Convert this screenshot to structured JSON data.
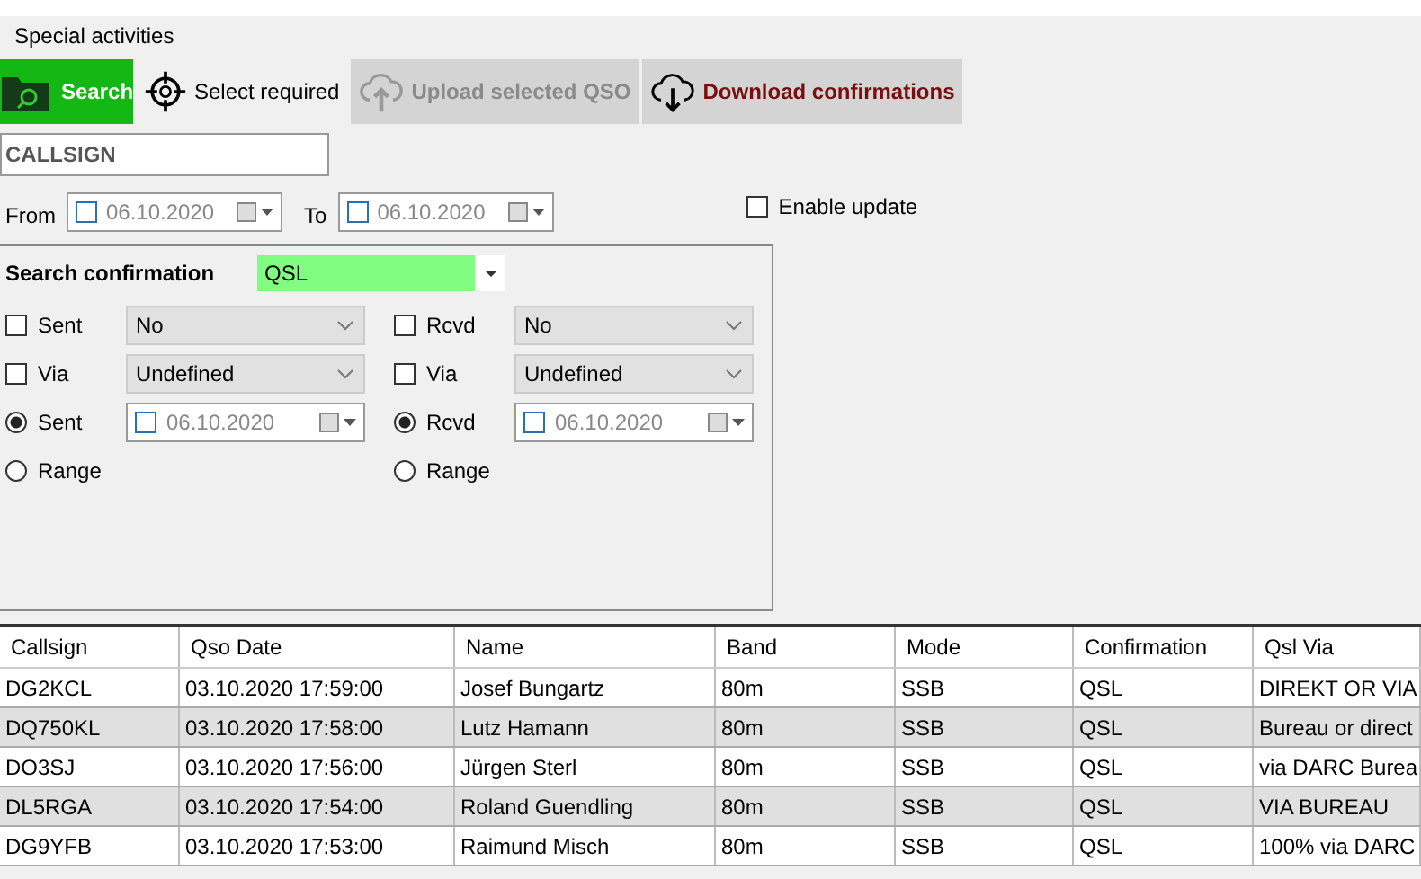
{
  "menu": {
    "items": [
      "Special activities"
    ]
  },
  "toolbar": [
    {
      "kind": "search",
      "label": "Search",
      "disabled": false
    },
    {
      "kind": "target",
      "label": "Select required",
      "disabled": false
    },
    {
      "kind": "upload",
      "label": "Upload selected QSO",
      "disabled": true
    },
    {
      "kind": "download",
      "label": "Download confirmations",
      "disabled": false
    }
  ],
  "callsign_field": {
    "placeholder": "CALLSIGN"
  },
  "date_range": {
    "from_label": "From",
    "from": {
      "value": "06.10.2020",
      "checked": false
    },
    "to_label": "To",
    "to": {
      "value": "06.10.2020",
      "checked": false
    }
  },
  "enable_update": {
    "label": "Enable update",
    "checked": false
  },
  "search_confirmation": {
    "label": "Search confirmation",
    "value": "QSL",
    "columns": [
      {
        "status": {
          "label": "Sent",
          "checked": false,
          "value": "No"
        },
        "via": {
          "label": "Via",
          "checked": false,
          "value": "Undefined"
        },
        "date_option": {
          "label": "Sent",
          "selected": true,
          "date": "06.10.2020",
          "date_checked": false
        },
        "range_option": {
          "label": "Range",
          "selected": false
        }
      },
      {
        "status": {
          "label": "Rcvd",
          "checked": false,
          "value": "No"
        },
        "via": {
          "label": "Via",
          "checked": false,
          "value": "Undefined"
        },
        "date_option": {
          "label": "Rcvd",
          "selected": true,
          "date": "06.10.2020",
          "date_checked": false
        },
        "range_option": {
          "label": "Range",
          "selected": false
        }
      }
    ]
  },
  "table": {
    "columns": [
      "Callsign",
      "Qso Date",
      "Name",
      "Band",
      "Mode",
      "Confirmation",
      "Qsl Via"
    ],
    "rows": [
      [
        "DG2KCL",
        "03.10.2020 17:59:00",
        "Josef Bungartz",
        "80m",
        "SSB",
        "QSL",
        "DIREKT OR VIA"
      ],
      [
        "DQ750KL",
        "03.10.2020 17:58:00",
        "Lutz Hamann",
        "80m",
        "SSB",
        "QSL",
        "Bureau or direct"
      ],
      [
        "DO3SJ",
        "03.10.2020 17:56:00",
        "Jürgen Sterl",
        "80m",
        "SSB",
        "QSL",
        "via DARC Burea"
      ],
      [
        "DL5RGA",
        "03.10.2020 17:54:00",
        "Roland Guendling",
        "80m",
        "SSB",
        "QSL",
        "VIA BUREAU"
      ],
      [
        "DG9YFB",
        "03.10.2020 17:53:00",
        "Raimund Misch",
        "80m",
        "SSB",
        "QSL",
        "100% via DARC"
      ]
    ]
  }
}
